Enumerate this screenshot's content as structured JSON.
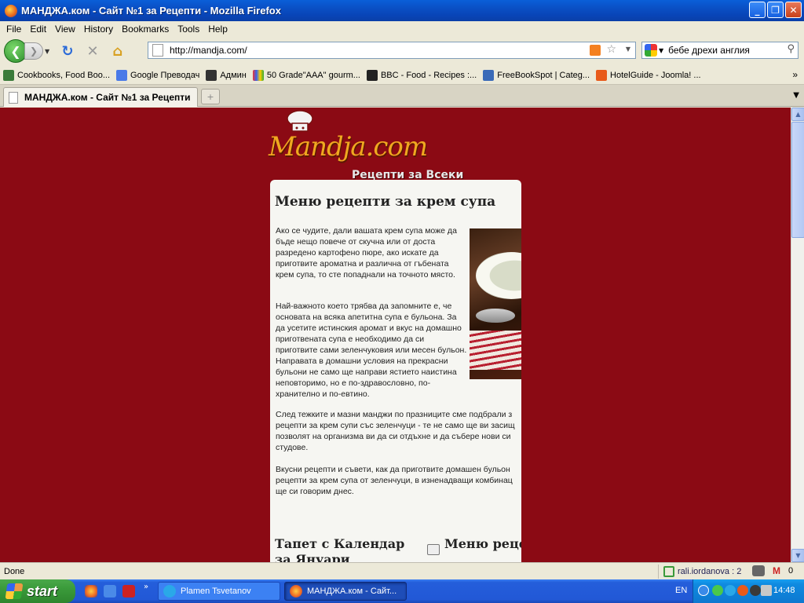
{
  "window": {
    "title": "МАНДЖА.ком - Сайт №1 за Рецепти - Mozilla Firefox",
    "minimize": "_",
    "restore": "❐",
    "close": "✕"
  },
  "menu": [
    "File",
    "Edit",
    "View",
    "History",
    "Bookmarks",
    "Tools",
    "Help"
  ],
  "nav": {
    "url": "http://mandja.com/",
    "search_value": "бебе дрехи англия"
  },
  "bookmarks": [
    {
      "label": "Cookbooks, Food Boo...",
      "icon": "cookbook-icon",
      "color": "#3a7a3a"
    },
    {
      "label": "Google Преводач",
      "icon": "translate-icon",
      "color": "#4a7ae8"
    },
    {
      "label": "Админ",
      "icon": "joomla-admin-icon",
      "color": "#333333"
    },
    {
      "label": "50 Grade\"AAA\" gourm...",
      "icon": "ebay-icon",
      "color": "#e8e8e8"
    },
    {
      "label": "BBC - Food - Recipes :...",
      "icon": "bbc-icon",
      "color": "#222222"
    },
    {
      "label": "FreeBookSpot | Categ...",
      "icon": "book-icon",
      "color": "#3a6ab8"
    },
    {
      "label": "HotelGuide - Joomla! ...",
      "icon": "joomla-icon",
      "color": "#e85a1a"
    }
  ],
  "bookmarks_more": "»",
  "tab": {
    "label": "МАНДЖА.ком - Сайт №1 за Рецепти",
    "new_tab": "+"
  },
  "page": {
    "logo_text": "Mandja.com",
    "tagline": "Рецепти за Всеки",
    "heading": "Меню рецепти за крем супа",
    "p1": "Ако се чудите, дали вашата крем супа може да бъде нещо повече от скучна или от доста разредено картофено пюре, ако искате да приготвите ароматна и различна от гъбената крем супа, то сте попаднали на точното място.",
    "p2": "Най-важното което трябва да запомните е, че основата на всяка апетитна супа е бульона. За да усетите истинския аромат и вкус на домашно приготвената супа е необходимо да си приготвите сами зеленчуковия или месен бульон. Направата в домашни условия на прекрасни бульони не само ще направи ястието наистина неповторимо, но е по-здравословно, по-хранително и по-евтино.",
    "p3_lines": [
      "След тежките и мазни манджи по празниците сме подбрали з",
      "рецепти за крем супи със зеленчуци - те не само ще ви засищ",
      "позволят на организма ви да си отдъхне и да събере нови си",
      "студове."
    ],
    "p4_lines": [
      "Вкусни рецепти и съвети, как да приготвите домашен бульон",
      "рецепти за крем супа от зеленчуци, в изненадващи комбинац",
      "ще си говорим днес."
    ],
    "bottom_left": "Тапет с Календар за Януари",
    "bottom_right": "Меню рецепти огретен"
  },
  "status": {
    "text": "Done",
    "user": "rali.iordanova : 2",
    "gmail_count": "0"
  },
  "taskbar": {
    "start": "start",
    "btn1": "Plamen Tsvetanov",
    "btn2": "МАНДЖА.ком - Сайт...",
    "lang": "EN",
    "clock": "14:48",
    "more": "»"
  }
}
